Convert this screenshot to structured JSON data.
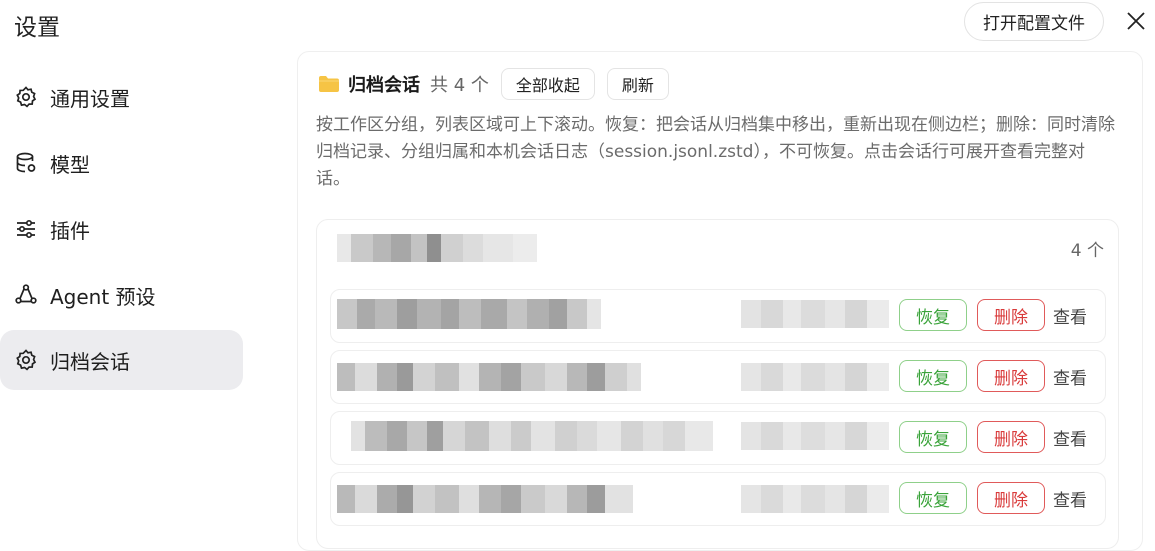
{
  "header": {
    "title": "设置",
    "open_config_label": "打开配置文件",
    "close_icon": "close-icon"
  },
  "sidebar": {
    "items": [
      {
        "label": "通用设置",
        "icon": "gear-icon",
        "active": false
      },
      {
        "label": "模型",
        "icon": "database-icon",
        "active": false
      },
      {
        "label": "插件",
        "icon": "sliders-icon",
        "active": false
      },
      {
        "label": "Agent 预设",
        "icon": "agent-icon",
        "active": false
      },
      {
        "label": "归档会话",
        "icon": "gear-icon",
        "active": true
      }
    ]
  },
  "archive": {
    "title": "归档会话",
    "count_text": "共 4 个",
    "collapse_all_label": "全部收起",
    "refresh_label": "刷新",
    "description": "按工作区分组，列表区域可上下滚动。恢复：把会话从归档集中移出，重新出现在侧边栏；删除：同时清除归档记录、分组归属和本机会话日志（session.jsonl.zstd），不可恢复。点击会话行可展开查看完整对话。",
    "group": {
      "count_text": "4 个",
      "rows": [
        {
          "restore_label": "恢复",
          "delete_label": "删除",
          "view_label": "查看"
        },
        {
          "restore_label": "恢复",
          "delete_label": "删除",
          "view_label": "查看"
        },
        {
          "restore_label": "恢复",
          "delete_label": "删除",
          "view_label": "查看"
        },
        {
          "restore_label": "恢复",
          "delete_label": "删除",
          "view_label": "查看"
        }
      ]
    }
  },
  "colors": {
    "active_nav_bg": "#ececef",
    "restore_green": "#3aa33a",
    "delete_red": "#d93a3a",
    "folder_yellow": "#f6c445"
  }
}
